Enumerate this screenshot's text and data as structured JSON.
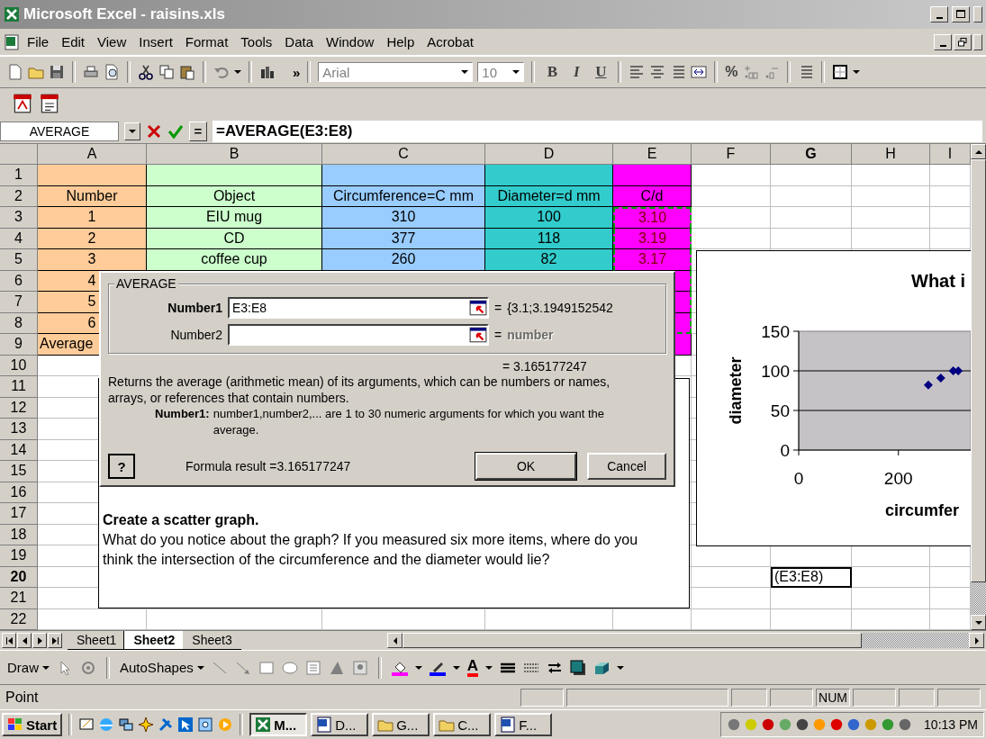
{
  "window": {
    "title": "Microsoft Excel - raisins.xls"
  },
  "menu": [
    "File",
    "Edit",
    "View",
    "Insert",
    "Format",
    "Tools",
    "Data",
    "Window",
    "Help",
    "Acrobat"
  ],
  "toolbar": {
    "more": "»",
    "font": "Arial",
    "size": "10",
    "styles": [
      "B",
      "I",
      "U"
    ],
    "percent": "%"
  },
  "formula_bar": {
    "name_box": "AVERAGE",
    "equals": "=",
    "formula": "=AVERAGE(E3:E8)"
  },
  "columns": [
    {
      "label": "A",
      "selected": false,
      "color": "#ffcc99"
    },
    {
      "label": "B",
      "selected": false,
      "color": "#ccffcc"
    },
    {
      "label": "C",
      "selected": false,
      "color": "#99ccff"
    },
    {
      "label": "D",
      "selected": false,
      "color": "#33cccc"
    },
    {
      "label": "E",
      "selected": false,
      "color": "#ff00ff"
    },
    {
      "label": "F",
      "selected": false
    },
    {
      "label": "G",
      "selected": true
    },
    {
      "label": "H",
      "selected": false
    },
    {
      "label": "I",
      "selected": false
    }
  ],
  "rows": [
    {
      "label": "1",
      "selected": false,
      "filled": true,
      "referenced": false,
      "kind": "data"
    },
    {
      "label": "2",
      "selected": false,
      "filled": true,
      "referenced": false,
      "kind": "data",
      "cells": {
        "A": "Number",
        "B": "Object",
        "C": "Circumference=C mm",
        "D": "Diameter=d mm",
        "E": "C/d"
      }
    },
    {
      "label": "3",
      "selected": false,
      "filled": true,
      "referenced": true,
      "kind": "data",
      "cells": {
        "A": "1",
        "B": "EIU mug",
        "C": "310",
        "D": "100",
        "E": "3.10"
      }
    },
    {
      "label": "4",
      "selected": false,
      "filled": true,
      "referenced": true,
      "kind": "data",
      "cells": {
        "A": "2",
        "B": "CD",
        "C": "377",
        "D": "118",
        "E": "3.19"
      }
    },
    {
      "label": "5",
      "selected": false,
      "filled": true,
      "referenced": true,
      "kind": "data",
      "cells": {
        "A": "3",
        "B": "coffee cup",
        "C": "260",
        "D": "82",
        "E": "3.17"
      }
    },
    {
      "label": "6",
      "selected": false,
      "filled": true,
      "referenced": true,
      "kind": "data",
      "cells": {
        "A": "4"
      }
    },
    {
      "label": "7",
      "selected": false,
      "filled": true,
      "referenced": true,
      "kind": "data",
      "cells": {
        "A": "5"
      }
    },
    {
      "label": "8",
      "selected": false,
      "filled": true,
      "referenced": true,
      "kind": "data",
      "cells": {
        "A": "6"
      }
    },
    {
      "label": "9",
      "selected": false,
      "filled": true,
      "referenced": false,
      "kind": "text",
      "cells": {
        "A": "Average"
      }
    },
    {
      "label": "10",
      "selected": false,
      "filled": false,
      "kind": "data"
    },
    {
      "label": "11",
      "selected": false,
      "filled": false,
      "kind": "data"
    },
    {
      "label": "12",
      "selected": false,
      "filled": false,
      "kind": "data"
    },
    {
      "label": "13",
      "selected": false,
      "filled": false,
      "kind": "data"
    },
    {
      "label": "14",
      "selected": false,
      "filled": false,
      "kind": "data"
    },
    {
      "label": "15",
      "selected": false,
      "filled": false,
      "kind": "data"
    },
    {
      "label": "16",
      "selected": false,
      "filled": false,
      "kind": "data"
    },
    {
      "label": "17",
      "selected": false,
      "filled": false,
      "kind": "data"
    },
    {
      "label": "18",
      "selected": false,
      "filled": false,
      "kind": "data"
    },
    {
      "label": "19",
      "selected": false,
      "filled": false,
      "kind": "data"
    },
    {
      "label": "20",
      "selected": true,
      "filled": false,
      "kind": "text",
      "cells": {
        "G": "(E3:E8)"
      }
    },
    {
      "label": "21",
      "selected": false,
      "filled": false,
      "kind": "data"
    },
    {
      "label": "22",
      "selected": false,
      "filled": false,
      "kind": "data"
    }
  ],
  "dialog": {
    "group": "AVERAGE",
    "arguments": [
      {
        "label": "Number1",
        "selected": true,
        "value": "E3:E8",
        "equals": "=",
        "result": "{3.1;3.1949152542",
        "greyed": false
      },
      {
        "label": "Number2",
        "selected": false,
        "equals": "=",
        "result": "number",
        "greyed": true
      }
    ],
    "value": "= 3.165177247",
    "description": "Returns the average (arithmetic mean) of its arguments, which can be numbers or names, arrays, or references that contain numbers.",
    "help_label": "Number1:",
    "help_text": "number1,number2,... are 1 to 30 numeric arguments for which you want the average.",
    "help_button": "?",
    "formula_result": "Formula result =3.165177247",
    "buttons": [
      "OK",
      "Cancel"
    ]
  },
  "note": {
    "title": "Create a scatter graph.",
    "text": "What do you notice about the graph? If you measured six more items, where do you think the intersection of the circumference and the diameter would lie?"
  },
  "chart": {
    "chart_data": {
      "type": "scatter",
      "title": "What i",
      "xlabel": "circumfer",
      "ylabel": "diameter",
      "x": [
        260,
        285,
        310,
        320
      ],
      "series": [
        {
          "color": "#000080",
          "values": [
            82,
            91,
            100,
            100
          ]
        }
      ],
      "xlim": [
        0,
        345
      ],
      "ylim": [
        0,
        150
      ],
      "xticks": [
        0,
        200
      ],
      "yticks": [
        0,
        50,
        100,
        150
      ]
    }
  },
  "sheet_tabs": [
    {
      "label": "Sheet1",
      "selected": false
    },
    {
      "label": "Sheet2",
      "selected": true
    },
    {
      "label": "Sheet3",
      "selected": false
    }
  ],
  "drawing_toolbar": {
    "draw": "Draw",
    "autoshapes": "AutoShapes",
    "font_color": "A"
  },
  "status_bar": {
    "mode": "Point",
    "indicators": [
      "NUM"
    ]
  },
  "taskbar": {
    "start": "Start",
    "buttons": [
      {
        "label": "M...",
        "kind": "excel",
        "selected": true
      },
      {
        "label": "D...",
        "kind": "word",
        "selected": false
      },
      {
        "label": "G...",
        "kind": "folder",
        "selected": false
      },
      {
        "label": "C...",
        "kind": "folder",
        "selected": false
      },
      {
        "label": "F...",
        "kind": "word",
        "selected": false
      }
    ],
    "clock": "10:13 PM"
  }
}
